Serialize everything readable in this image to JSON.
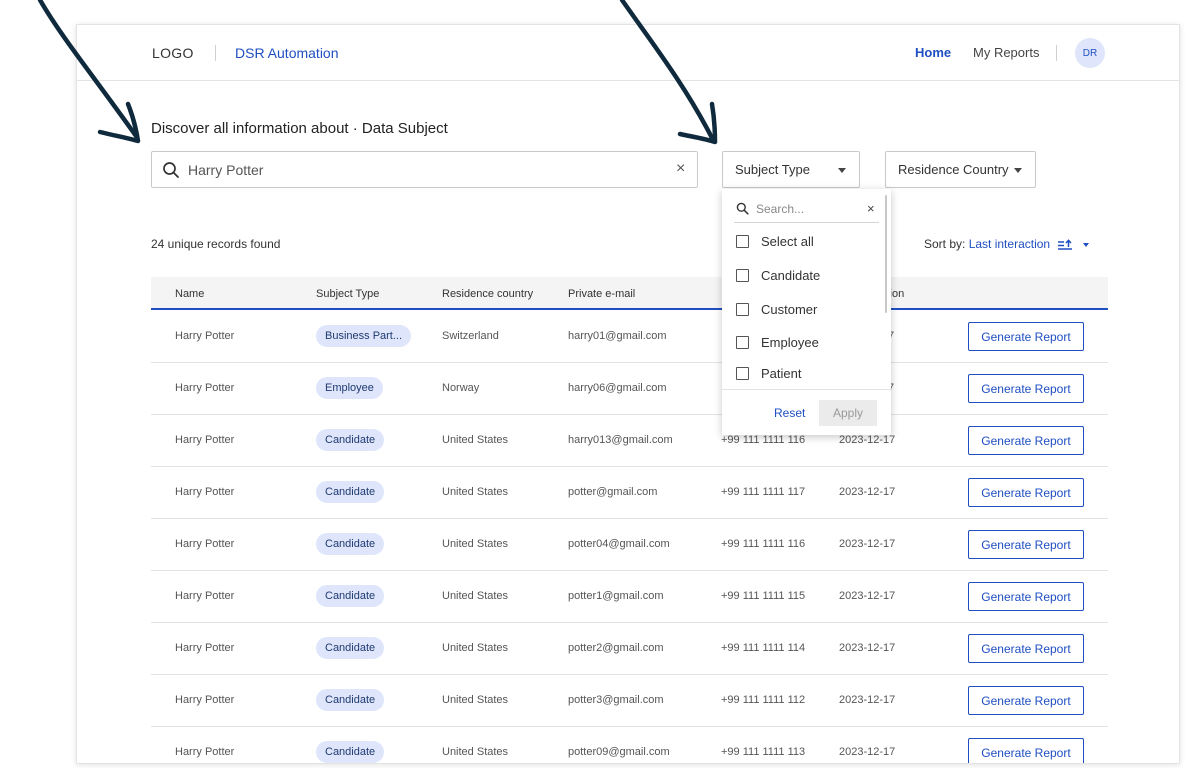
{
  "header": {
    "logo": "LOGO",
    "app_title": "DSR Automation",
    "nav_home": "Home",
    "nav_reports": "My Reports",
    "avatar_initials": "DR"
  },
  "main": {
    "title": "Discover all information about · Data Subject",
    "search_value": "Harry Potter",
    "clear_symbol": "×",
    "filters": {
      "subject_type": "Subject Type",
      "residence_country": "Residence Country"
    },
    "records_found": "24 unique records found",
    "sort_label": "Sort by:",
    "sort_value": "Last interaction"
  },
  "table": {
    "columns": [
      "Name",
      "Subject Type",
      "Residence country",
      "Private e-mail",
      "ction"
    ],
    "rows": [
      {
        "name": "Harry Potter",
        "type": "Business Part...",
        "country": "Switzerland",
        "email": "harry01@gmail.com",
        "phone": "",
        "date": "7",
        "action": "Generate Report"
      },
      {
        "name": "Harry Potter",
        "type": "Employee",
        "country": "Norway",
        "email": "harry06@gmail.com",
        "phone": "",
        "date": "7",
        "action": "Generate Report"
      },
      {
        "name": "Harry Potter",
        "type": "Candidate",
        "country": "United States",
        "email": "harry013@gmail.com",
        "phone": "+99 111 1111 116",
        "date": "2023-12-17",
        "action": "Generate Report"
      },
      {
        "name": "Harry Potter",
        "type": "Candidate",
        "country": "United States",
        "email": "potter@gmail.com",
        "phone": "+99 111 1111 117",
        "date": "2023-12-17",
        "action": "Generate Report"
      },
      {
        "name": "Harry Potter",
        "type": "Candidate",
        "country": "United States",
        "email": "potter04@gmail.com",
        "phone": "+99 111 1111 116",
        "date": "2023-12-17",
        "action": "Generate Report"
      },
      {
        "name": "Harry Potter",
        "type": "Candidate",
        "country": "United States",
        "email": "potter1@gmail.com",
        "phone": "+99 111 1111 115",
        "date": "2023-12-17",
        "action": "Generate Report"
      },
      {
        "name": "Harry Potter",
        "type": "Candidate",
        "country": "United States",
        "email": "potter2@gmail.com",
        "phone": "+99 111 1111 114",
        "date": "2023-12-17",
        "action": "Generate Report"
      },
      {
        "name": "Harry Potter",
        "type": "Candidate",
        "country": "United States",
        "email": "potter3@gmail.com",
        "phone": "+99 111 1111 112",
        "date": "2023-12-17",
        "action": "Generate Report"
      },
      {
        "name": "Harry Potter",
        "type": "Candidate",
        "country": "United States",
        "email": "potter09@gmail.com",
        "phone": "+99 111 1111 113",
        "date": "2023-12-17",
        "action": "Generate Report"
      }
    ]
  },
  "dropdown": {
    "search_placeholder": "Search...",
    "options": [
      "Select all",
      "Candidate",
      "Customer",
      "Employee",
      "Patient"
    ],
    "reset_label": "Reset",
    "apply_label": "Apply"
  },
  "icons": {
    "search": "search-icon",
    "clear": "close-icon",
    "caret": "caret-down-icon",
    "sort": "sort-icon",
    "checkbox": "checkbox-icon",
    "annotation_arrow": "arrow-annotation"
  },
  "colors": {
    "accent": "#1f4fc1",
    "badge_bg": "#dfe6fb",
    "badge_text": "#1e3a70",
    "arrow": "#0f2a3d"
  }
}
